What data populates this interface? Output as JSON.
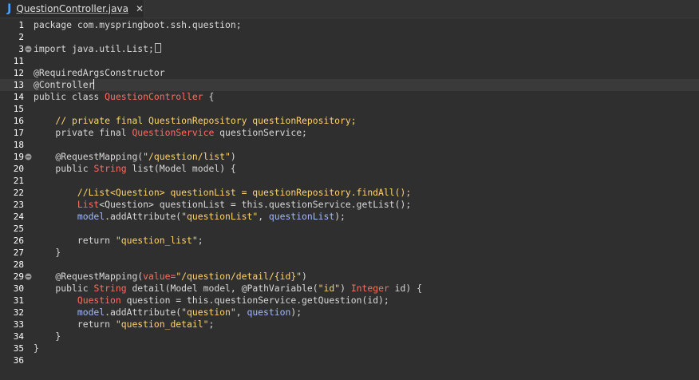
{
  "window": {
    "tab": {
      "icon": "java-file-icon",
      "icon_glyph": "J",
      "title": "QuestionController.java",
      "close_glyph": "✕"
    }
  },
  "editor": {
    "lines": [
      {
        "n": "1",
        "fold": false,
        "tokens": [
          {
            "t": "package",
            "c": "kw"
          },
          {
            "t": " com.myspringboot.ssh.question;",
            "c": "pl"
          }
        ]
      },
      {
        "n": "2",
        "fold": false,
        "tokens": []
      },
      {
        "n": "3",
        "fold": true,
        "tokens": [
          {
            "t": "import",
            "c": "kw"
          },
          {
            "t": " java.util.List;",
            "c": "pl"
          }
        ],
        "trailing_box": true
      },
      {
        "n": "11",
        "fold": false,
        "tokens": []
      },
      {
        "n": "12",
        "fold": false,
        "tokens": [
          {
            "t": "@RequiredArgsConstructor",
            "c": "an"
          }
        ]
      },
      {
        "n": "13",
        "fold": false,
        "hl": true,
        "caret": true,
        "tokens": [
          {
            "t": "@Controller",
            "c": "an"
          }
        ]
      },
      {
        "n": "14",
        "fold": false,
        "tokens": [
          {
            "t": "public class ",
            "c": "kw"
          },
          {
            "t": "QuestionController",
            "c": "cls"
          },
          {
            "t": " {",
            "c": "pl"
          }
        ]
      },
      {
        "n": "15",
        "fold": false,
        "tokens": []
      },
      {
        "n": "16",
        "fold": false,
        "tokens": [
          {
            "t": "    // private final QuestionRepository questionRepository;",
            "c": "cm"
          }
        ]
      },
      {
        "n": "17",
        "fold": false,
        "tokens": [
          {
            "t": "    private final ",
            "c": "kw"
          },
          {
            "t": "QuestionService",
            "c": "cls"
          },
          {
            "t": " questionService;",
            "c": "pl"
          }
        ]
      },
      {
        "n": "18",
        "fold": false,
        "tokens": []
      },
      {
        "n": "19",
        "fold": true,
        "tokens": [
          {
            "t": "    @RequestMapping(",
            "c": "an"
          },
          {
            "t": "\"/question/list\"",
            "c": "str"
          },
          {
            "t": ")",
            "c": "pl"
          }
        ]
      },
      {
        "n": "20",
        "fold": false,
        "tokens": [
          {
            "t": "    public ",
            "c": "kw"
          },
          {
            "t": "String",
            "c": "cls"
          },
          {
            "t": " list(",
            "c": "pl"
          },
          {
            "t": "Model",
            "c": "pl"
          },
          {
            "t": " model) {",
            "c": "pl"
          }
        ]
      },
      {
        "n": "21",
        "fold": false,
        "tokens": []
      },
      {
        "n": "22",
        "fold": false,
        "tokens": [
          {
            "t": "        //List<Question> questionList = questionRepository.findAll();",
            "c": "cm"
          }
        ]
      },
      {
        "n": "23",
        "fold": false,
        "tokens": [
          {
            "t": "        List",
            "c": "cls"
          },
          {
            "t": "<Question> questionList = ",
            "c": "pl"
          },
          {
            "t": "this",
            "c": "kw"
          },
          {
            "t": ".questionService.getList();",
            "c": "pl"
          }
        ]
      },
      {
        "n": "24",
        "fold": false,
        "tokens": [
          {
            "t": "        model",
            "c": "var"
          },
          {
            "t": ".addAttribute(",
            "c": "pl"
          },
          {
            "t": "\"questionList\"",
            "c": "str"
          },
          {
            "t": ", ",
            "c": "pl"
          },
          {
            "t": "questionList",
            "c": "var"
          },
          {
            "t": ");",
            "c": "pl"
          }
        ]
      },
      {
        "n": "25",
        "fold": false,
        "tokens": []
      },
      {
        "n": "26",
        "fold": false,
        "tokens": [
          {
            "t": "        return ",
            "c": "kw"
          },
          {
            "t": "\"question_list\"",
            "c": "str"
          },
          {
            "t": ";",
            "c": "pl"
          }
        ]
      },
      {
        "n": "27",
        "fold": false,
        "tokens": [
          {
            "t": "    }",
            "c": "pl"
          }
        ]
      },
      {
        "n": "28",
        "fold": false,
        "tokens": []
      },
      {
        "n": "29",
        "fold": true,
        "tokens": [
          {
            "t": "    @RequestMapping(",
            "c": "an"
          },
          {
            "t": "value=",
            "c": "cls"
          },
          {
            "t": "\"/question/detail/{id}\"",
            "c": "str"
          },
          {
            "t": ")",
            "c": "pl"
          }
        ]
      },
      {
        "n": "30",
        "fold": false,
        "tokens": [
          {
            "t": "    public ",
            "c": "kw"
          },
          {
            "t": "String",
            "c": "cls"
          },
          {
            "t": " detail(",
            "c": "pl"
          },
          {
            "t": "Model",
            "c": "pl"
          },
          {
            "t": " model, ",
            "c": "pl"
          },
          {
            "t": "@PathVariable(",
            "c": "an"
          },
          {
            "t": "\"id\"",
            "c": "str"
          },
          {
            "t": ") ",
            "c": "pl"
          },
          {
            "t": "Integer",
            "c": "cls"
          },
          {
            "t": " id) {",
            "c": "pl"
          }
        ]
      },
      {
        "n": "31",
        "fold": false,
        "tokens": [
          {
            "t": "        Question",
            "c": "cls"
          },
          {
            "t": " question = ",
            "c": "pl"
          },
          {
            "t": "this",
            "c": "kw"
          },
          {
            "t": ".questionService.getQuestion(id);",
            "c": "pl"
          }
        ]
      },
      {
        "n": "32",
        "fold": false,
        "tokens": [
          {
            "t": "        model",
            "c": "var"
          },
          {
            "t": ".addAttribute(",
            "c": "pl"
          },
          {
            "t": "\"question\"",
            "c": "str"
          },
          {
            "t": ", ",
            "c": "pl"
          },
          {
            "t": "question",
            "c": "var"
          },
          {
            "t": ");",
            "c": "pl"
          }
        ]
      },
      {
        "n": "33",
        "fold": false,
        "tokens": [
          {
            "t": "        return ",
            "c": "kw"
          },
          {
            "t": "\"question_detail\"",
            "c": "str"
          },
          {
            "t": ";",
            "c": "pl"
          }
        ]
      },
      {
        "n": "34",
        "fold": false,
        "tokens": [
          {
            "t": "    }",
            "c": "pl"
          }
        ]
      },
      {
        "n": "35",
        "fold": false,
        "tokens": [
          {
            "t": "}",
            "c": "pl"
          }
        ]
      },
      {
        "n": "36",
        "fold": false,
        "tokens": []
      }
    ]
  },
  "colors": {
    "background": "#2f2f2f",
    "keyword": "#d8d8d8",
    "type": "#ff6b60",
    "string": "#ffd36b",
    "comment": "#ffd36b",
    "variable": "#a0b9ff",
    "line_numbers": "#ffffff"
  }
}
